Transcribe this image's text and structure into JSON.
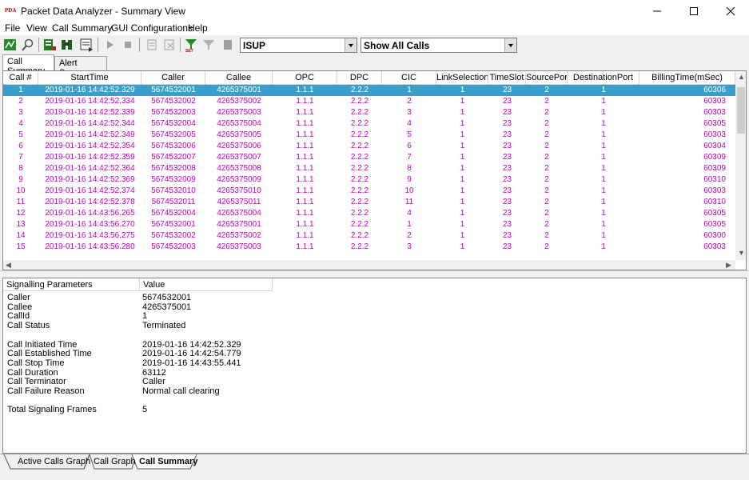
{
  "window": {
    "title": "Packet Data Analyzer - Summary View",
    "app_icon_text": "PDA"
  },
  "menu": [
    "File",
    "View",
    "Call Summary",
    "GUI Configurations",
    "Help"
  ],
  "toolbar": {
    "protocol_value": "ISUP",
    "filter_value": "Show All Calls",
    "buttons": [
      "analyze-icon",
      "search-icon",
      "export-icon",
      "binoculars-icon",
      "report-icon",
      "play-icon",
      "stop-icon",
      "copy-icon",
      "paste-icon",
      "set-filter-icon",
      "clear-filter-icon",
      "disabled-icon"
    ]
  },
  "top_tabs": [
    "Call Summary",
    "Alert Summary"
  ],
  "grid": {
    "columns": [
      "Call #",
      "StartTime",
      "Caller",
      "Callee",
      "OPC",
      "DPC",
      "CIC",
      "LinkSelection",
      "TimeSlot",
      "SourcePort",
      "DestinationPort",
      "BillingTime(mSec)"
    ],
    "rows": [
      [
        "1",
        "2019-01-16 14:42:52.329",
        "5674532001",
        "4265375001",
        "1.1.1",
        "2.2.2",
        "1",
        "1",
        "23",
        "2",
        "1",
        "60306"
      ],
      [
        "2",
        "2019-01-16 14:42:52.334",
        "5674532002",
        "4265375002",
        "1.1.1",
        "2.2.2",
        "2",
        "1",
        "23",
        "2",
        "1",
        "60303"
      ],
      [
        "3",
        "2019-01-16 14:42:52.339",
        "5674532003",
        "4265375003",
        "1.1.1",
        "2.2.2",
        "3",
        "1",
        "23",
        "2",
        "1",
        "60303"
      ],
      [
        "4",
        "2019-01-16 14:42:52.344",
        "5674532004",
        "4265375004",
        "1.1.1",
        "2.2.2",
        "4",
        "1",
        "23",
        "2",
        "1",
        "60305"
      ],
      [
        "5",
        "2019-01-16 14:42:52.349",
        "5674532005",
        "4265375005",
        "1.1.1",
        "2.2.2",
        "5",
        "1",
        "23",
        "2",
        "1",
        "60303"
      ],
      [
        "6",
        "2019-01-16 14:42:52.354",
        "5674532006",
        "4265375006",
        "1.1.1",
        "2.2.2",
        "6",
        "1",
        "23",
        "2",
        "1",
        "60304"
      ],
      [
        "7",
        "2019-01-16 14:42:52.359",
        "5674532007",
        "4265375007",
        "1.1.1",
        "2.2.2",
        "7",
        "1",
        "23",
        "2",
        "1",
        "60309"
      ],
      [
        "8",
        "2019-01-16 14:42:52.364",
        "5674532008",
        "4265375008",
        "1.1.1",
        "2.2.2",
        "8",
        "1",
        "23",
        "2",
        "1",
        "60309"
      ],
      [
        "9",
        "2019-01-16 14:42:52.369",
        "5674532009",
        "4265375009",
        "1.1.1",
        "2.2.2",
        "9",
        "1",
        "23",
        "2",
        "1",
        "60310"
      ],
      [
        "10",
        "2019-01-16 14:42:52.374",
        "5674532010",
        "4265375010",
        "1.1.1",
        "2.2.2",
        "10",
        "1",
        "23",
        "2",
        "1",
        "60303"
      ],
      [
        "11",
        "2019-01-16 14:42:52.378",
        "5674532011",
        "4265375011",
        "1.1.1",
        "2.2.2",
        "11",
        "1",
        "23",
        "2",
        "1",
        "60310"
      ],
      [
        "12",
        "2019-01-16 14:43:56.265",
        "5674532004",
        "4265375004",
        "1.1.1",
        "2.2.2",
        "4",
        "1",
        "23",
        "2",
        "1",
        "60305"
      ],
      [
        "13",
        "2019-01-16 14:43:56.270",
        "5674532001",
        "4265375001",
        "1.1.1",
        "2.2.2",
        "1",
        "1",
        "23",
        "2",
        "1",
        "60305"
      ],
      [
        "14",
        "2019-01-16 14:43:56.275",
        "5674532002",
        "4265375002",
        "1.1.1",
        "2.2.2",
        "2",
        "1",
        "23",
        "2",
        "1",
        "60300"
      ],
      [
        "15",
        "2019-01-16 14:43:56.280",
        "5674532003",
        "4265375003",
        "1.1.1",
        "2.2.2",
        "3",
        "1",
        "23",
        "2",
        "1",
        "60303"
      ]
    ],
    "selected_row": 0
  },
  "params": {
    "headers": [
      "Signalling Parameters",
      "Value"
    ],
    "rows": [
      [
        "Caller",
        "5674532001"
      ],
      [
        "Callee",
        "4265375001"
      ],
      [
        "CallId",
        "1"
      ],
      [
        "Call Status",
        "Terminated"
      ],
      [
        "",
        ""
      ],
      [
        "Call Initiated Time",
        "2019-01-16 14:42:52.329"
      ],
      [
        "Call Established Time",
        "2019-01-16 14:42:54.779"
      ],
      [
        "Call Stop Time",
        "2019-01-16 14:43:55.441"
      ],
      [
        "Call Duration",
        "63112"
      ],
      [
        "Call Terminator",
        "Caller"
      ],
      [
        "Call Failure Reason",
        "Normal call clearing"
      ],
      [
        "",
        ""
      ],
      [
        "Total Signaling Frames",
        "5"
      ]
    ]
  },
  "bottom_tabs": [
    "Active Calls Graph",
    "Call Graph",
    "Call Summary"
  ],
  "colors": {
    "row_text": "#c000c0",
    "selection": "#3a9ecb"
  }
}
